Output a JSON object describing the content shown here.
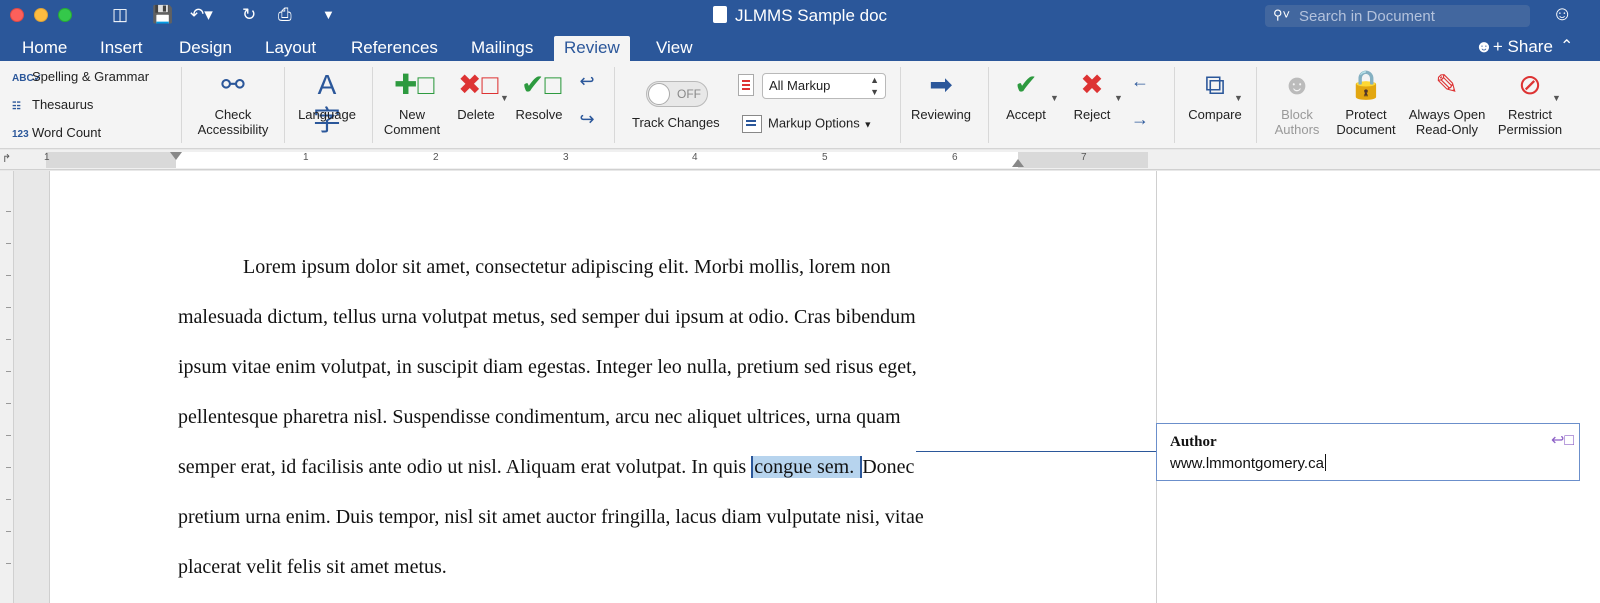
{
  "window": {
    "title": "JLMMS Sample doc",
    "search_placeholder": "Search in Document"
  },
  "tabs": [
    "Home",
    "Insert",
    "Design",
    "Layout",
    "References",
    "Mailings",
    "Review",
    "View"
  ],
  "active_tab": "Review",
  "share_label": "Share",
  "proofing": [
    "Spelling & Grammar",
    "Thesaurus",
    "Word Count"
  ],
  "ribbon": {
    "check_accessibility": [
      "Check",
      "Accessibility"
    ],
    "language": "Language",
    "new_comment": [
      "New",
      "Comment"
    ],
    "delete": "Delete",
    "resolve": "Resolve",
    "track_changes": "Track Changes",
    "toggle_state": "OFF",
    "markup_select": "All Markup",
    "markup_options": "Markup Options",
    "reviewing": "Reviewing",
    "accept": "Accept",
    "reject": "Reject",
    "compare": "Compare",
    "block_authors": [
      "Block",
      "Authors"
    ],
    "protect_document": [
      "Protect",
      "Document"
    ],
    "always_open_read_only": [
      "Always Open",
      "Read-Only"
    ],
    "restrict_permission": [
      "Restrict",
      "Permission"
    ]
  },
  "ruler": {
    "numbers": [
      "1",
      "1",
      "2",
      "3",
      "4",
      "5",
      "6",
      "7"
    ]
  },
  "document": {
    "lines": [
      "Lorem ipsum dolor sit amet, consectetur adipiscing elit. Morbi mollis, lorem non",
      "malesuada dictum, tellus urna volutpat metus, sed semper dui ipsum at odio. Cras bibendum",
      "ipsum vitae enim volutpat, in suscipit diam egestas. Integer leo nulla, pretium sed risus eget,",
      "pellentesque pharetra nisl. Suspendisse condimentum, arcu nec aliquet ultrices, urna quam",
      "semper erat, id facilisis ante odio ut nisl. Aliquam erat volutpat. In quis ",
      "pretium urna enim. Duis tempor, nisl sit amet auctor fringilla, lacus diam vulputate nisi, vitae",
      "placerat velit felis sit amet metus."
    ],
    "highlighted": "congue sem. ",
    "after_highlight": "Donec"
  },
  "comment": {
    "author": "Author",
    "text": "www.lmmontgomery.ca"
  },
  "colors": {
    "brand_blue": "#2b579a",
    "highlight": "#b7d4ee"
  }
}
